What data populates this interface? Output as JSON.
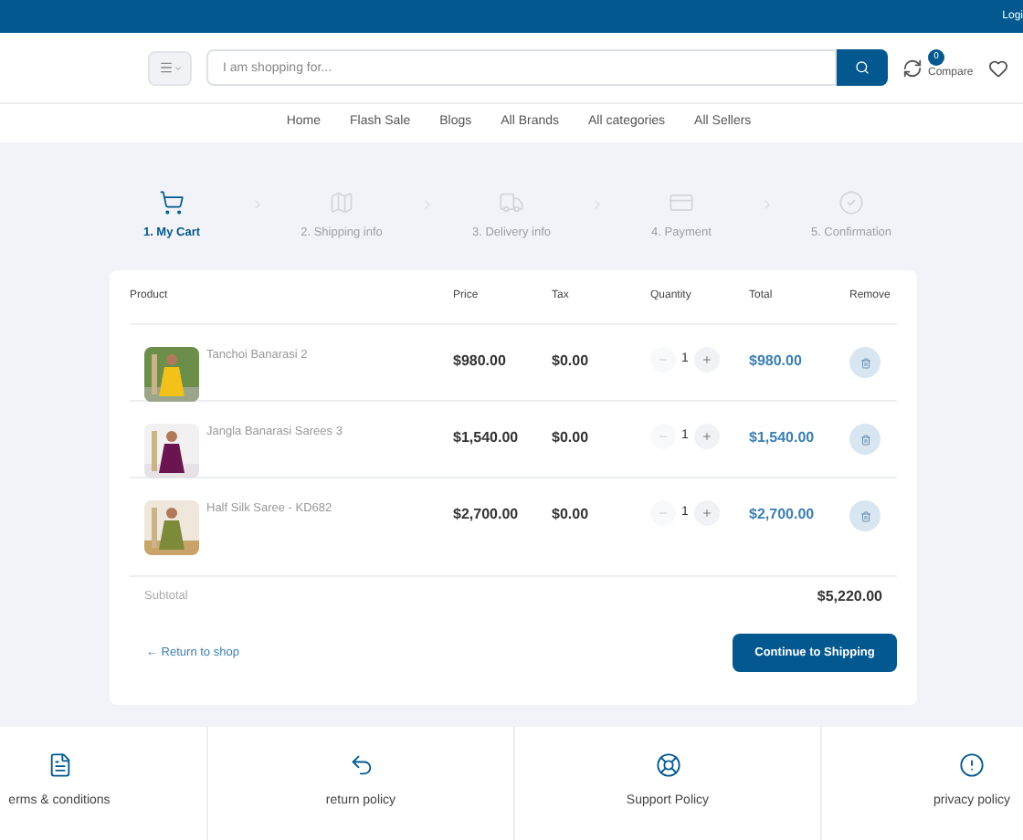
{
  "top_bar": {
    "login": "Logi"
  },
  "header": {
    "search": {
      "placeholder": "I am shopping for..."
    },
    "compare": {
      "count": "0",
      "label": "Compare"
    }
  },
  "nav": [
    "Home",
    "Flash Sale",
    "Blogs",
    "All Brands",
    "All categories",
    "All Sellers"
  ],
  "steps": [
    {
      "label": "1. My Cart",
      "selected": true
    },
    {
      "label": "2. Shipping info",
      "selected": false
    },
    {
      "label": "3. Delivery info",
      "selected": false
    },
    {
      "label": "4. Payment",
      "selected": false
    },
    {
      "label": "5. Confirmation",
      "selected": false
    }
  ],
  "cart": {
    "columns": [
      "Product",
      "Price",
      "Tax",
      "Quantity",
      "Total",
      "Remove"
    ],
    "rows": [
      {
        "name": "Tanchoi Banarasi 2",
        "price": "$980.00",
        "tax": "$0.00",
        "quantity": "1",
        "total": "$980.00"
      },
      {
        "name": "Jangla Banarasi Sarees 3",
        "price": "$1,540.00",
        "tax": "$0.00",
        "quantity": "1",
        "total": "$1,540.00"
      },
      {
        "name": "Half Silk Saree - KD682",
        "price": "$2,700.00",
        "tax": "$0.00",
        "quantity": "1",
        "total": "$2,700.00"
      }
    ],
    "subtotal_label": "Subtotal",
    "subtotal": "$5,220.00",
    "return_link": "← Return to shop",
    "continue_button": "Continue to Shipping"
  },
  "footer": [
    "erms & conditions",
    "return policy",
    "Support Policy",
    "privacy policy"
  ]
}
